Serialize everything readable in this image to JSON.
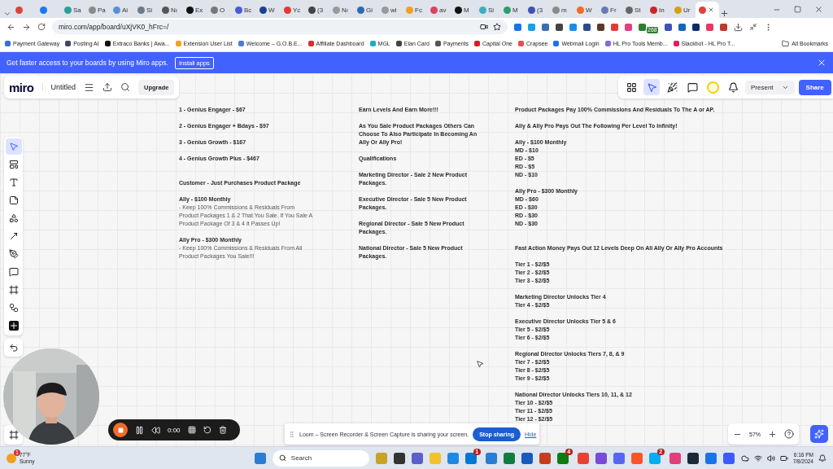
{
  "browser": {
    "tabs": [
      {
        "selected": false,
        "color": "#e0413b"
      },
      {
        "selected": false,
        "color": "#1877f2"
      },
      {
        "label": "Sa",
        "selected": false,
        "color": "#2aa198"
      },
      {
        "label": "Pa",
        "selected": false,
        "color": "#8a8a8a"
      },
      {
        "label": "Ai",
        "selected": false,
        "color": "#5a8fd8"
      },
      {
        "label": "Si",
        "selected": false,
        "color": "#6a7a8a"
      },
      {
        "label": "Nı",
        "selected": false,
        "color": "#555555"
      },
      {
        "label": "Ex",
        "selected": false,
        "color": "#111111"
      },
      {
        "label": "O",
        "selected": false,
        "color": "#777777"
      },
      {
        "label": "Bc",
        "selected": false,
        "color": "#4a5bd4"
      },
      {
        "label": "W",
        "selected": false,
        "color": "#1d3f8f"
      },
      {
        "label": "Yc",
        "selected": false,
        "color": "#e53935"
      },
      {
        "label": "(3",
        "selected": false,
        "color": "#444444"
      },
      {
        "label": "Nı",
        "selected": false,
        "color": "#999999"
      },
      {
        "label": "Gi",
        "selected": false,
        "color": "#2b6cb0"
      },
      {
        "label": "wi",
        "selected": false,
        "color": "#9a9a9a"
      },
      {
        "label": "Fc",
        "selected": false,
        "color": "#f0a020"
      },
      {
        "label": "av",
        "selected": false,
        "color": "#e04060"
      },
      {
        "label": "M",
        "selected": false,
        "color": "#111111"
      },
      {
        "label": "Si",
        "selected": false,
        "color": "#3ab0c0"
      },
      {
        "label": "M",
        "selected": false,
        "color": "#2e9e6a"
      },
      {
        "label": "(3",
        "selected": false,
        "color": "#3f51b5"
      },
      {
        "label": "m",
        "selected": false,
        "color": "#8a8a8a"
      },
      {
        "label": "W",
        "selected": false,
        "color": "#f06a2a"
      },
      {
        "label": "Fr",
        "selected": false,
        "color": "#6a7ab0"
      },
      {
        "label": "St",
        "selected": false,
        "color": "#666666"
      },
      {
        "label": "In",
        "selected": false,
        "color": "#c62828"
      },
      {
        "label": "Ur",
        "selected": false,
        "color": "#d4a017"
      },
      {
        "selected": true,
        "color": "#e0413b"
      }
    ],
    "url": "miro.com/app/board/uXjVK0_hFrc=/",
    "extensions": [
      {
        "color": "#1a73e8"
      },
      {
        "color": "#1aa0e8"
      },
      {
        "color": "#3b6fb0"
      },
      {
        "color": "#444444"
      },
      {
        "color": "#1a8fe8"
      },
      {
        "color": "#2b4a8a"
      },
      {
        "color": "#5a3a2a"
      },
      {
        "color": "#e53935"
      },
      {
        "color": "#e04080"
      },
      {
        "color": "#2e7d32",
        "badge": "268"
      },
      {
        "color": "#3f51b5"
      },
      {
        "color": "#1565c0"
      },
      {
        "color": "#0d2a6a"
      },
      {
        "color": "#e53960"
      },
      {
        "color": "#c0392b"
      }
    ],
    "bookmarks": [
      {
        "label": "Payment Gateway",
        "color": "#3b6fd4"
      },
      {
        "label": "Posting AI",
        "color": "#444466"
      },
      {
        "label": "Extraco Banks | Awa...",
        "color": "#111111"
      },
      {
        "label": "Extension User List",
        "color": "#f4a020"
      },
      {
        "label": "Welcome – G.O.B.E...",
        "color": "#4c7bd9"
      },
      {
        "label": "Affiliate Dashboard",
        "color": "#d63030"
      },
      {
        "label": "MGL",
        "color": "#22aabb"
      },
      {
        "label": "Elan Card",
        "color": "#444444"
      },
      {
        "label": "Payments",
        "color": "#555555"
      },
      {
        "label": "Capital One",
        "color": "#d22020"
      },
      {
        "label": "Crapsee",
        "color": "#e55050"
      },
      {
        "label": "Webmail Login",
        "color": "#1a73e8"
      },
      {
        "label": "HL Pro Tools Memb...",
        "color": "#8a6ad0"
      },
      {
        "label": "Slackbot - HL Pro T...",
        "color": "#e01e5a"
      }
    ],
    "all_bookmarks": "All Bookmarks"
  },
  "banner": {
    "text": "Get faster access to your boards by using Miro apps.",
    "button": "Install apps"
  },
  "miro": {
    "logo": "miro",
    "board_title": "Untitled",
    "upgrade": "Upgrade",
    "present": "Present",
    "share": "Share",
    "top_tools": [
      {
        "kind": "apps",
        "selected": false
      },
      {
        "kind": "cursor",
        "selected": true
      },
      {
        "kind": "party",
        "selected": false
      },
      {
        "kind": "comment",
        "selected": false
      },
      {
        "kind": "avatar",
        "selected": false
      },
      {
        "kind": "bell",
        "selected": false
      }
    ],
    "left_tools": [
      {
        "kind": "select",
        "selected": true
      },
      {
        "kind": "template",
        "selected": false
      },
      {
        "kind": "text",
        "selected": false
      },
      {
        "kind": "sticky",
        "selected": false
      },
      {
        "kind": "shapes",
        "selected": false
      },
      {
        "kind": "line",
        "selected": false
      },
      {
        "kind": "pen",
        "selected": false
      },
      {
        "kind": "comment",
        "selected": false
      },
      {
        "kind": "frame",
        "selected": false
      },
      {
        "kind": "diagram",
        "selected": false
      },
      {
        "kind": "more",
        "selected": false
      }
    ],
    "zoom": "57%",
    "canvas": {
      "columns": [
        {
          "groups": [
            [
              [
                {
                  "text": "1 - Genius Engager - $67",
                  "kind": "bold"
                }
              ],
              [
                {
                  "text": "2 - Genius Engager + Bdays - $97",
                  "kind": "bold"
                }
              ],
              [
                {
                  "text": "3 - Genius Growth - $167",
                  "kind": "bold"
                }
              ],
              [
                {
                  "text": "4 - Genius Growth Plus - $467",
                  "kind": "bold"
                }
              ]
            ],
            [
              [
                {
                  "text": "Customer - Just Purchases Product Package",
                  "kind": "bold"
                }
              ],
              [
                {
                  "text": "Ally - $100 Monthly",
                  "kind": "bold"
                },
                {
                  "text": "- Keep 100% Commissions & Residuals From Product Packages 1 & 2 That You Sale. If You Sale A Product Package Of 3 & 4 It Passes Up!",
                  "kind": "plain"
                }
              ],
              [
                {
                  "text": "Ally Pro - $300 Monthly",
                  "kind": "bold"
                },
                {
                  "text": "- Keep 100% Commissions & Residuals From All Product Packages You Sale!!!",
                  "kind": "plain"
                }
              ]
            ]
          ]
        },
        {
          "groups": [
            [
              [
                {
                  "text": "Earn Levels And Earn More!!!",
                  "kind": "bold"
                }
              ],
              [
                {
                  "text": "As You Sale Product Packages Others Can Choose To Also Participate In Becoming An Ally Or Ally Pro!",
                  "kind": "bold"
                }
              ],
              [
                {
                  "text": "Qualifications",
                  "kind": "bold"
                }
              ],
              [
                {
                  "text": "Marketing Director - Sale 2 New Product Packages.",
                  "kind": "bold"
                }
              ],
              [
                {
                  "text": "Executive Director - Sale 5 New Product Packages.",
                  "kind": "bold"
                }
              ],
              [
                {
                  "text": "Regional Director - Sale 5 New Product Packages.",
                  "kind": "bold"
                }
              ],
              [
                {
                  "text": "National Director - Sale 5 New Product Packages.",
                  "kind": "bold"
                }
              ]
            ]
          ]
        },
        {
          "groups": [
            [
              [
                {
                  "text": "Product Packages Pay 100% Commissions And Residuals To The A or AP.",
                  "kind": "bold"
                }
              ],
              [
                {
                  "text": "Ally & Ally Pro Pays Out The Following Per Level To Infinity!",
                  "kind": "bold"
                }
              ],
              [
                {
                  "text": "Ally - $100 Monthly",
                  "kind": "bold"
                },
                {
                  "text": "MD - $10",
                  "kind": "bold"
                },
                {
                  "text": "ED - $5",
                  "kind": "bold"
                },
                {
                  "text": "RD - $5",
                  "kind": "bold"
                },
                {
                  "text": "ND - $10",
                  "kind": "bold"
                }
              ],
              [
                {
                  "text": "Ally Pro - $300 Monthly",
                  "kind": "bold"
                },
                {
                  "text": "MD - $60",
                  "kind": "bold"
                },
                {
                  "text": "ED - $30",
                  "kind": "bold"
                },
                {
                  "text": "RD - $30",
                  "kind": "bold"
                },
                {
                  "text": "ND - $30",
                  "kind": "bold"
                }
              ]
            ],
            [
              [
                {
                  "text": "Fast Action Money Pays Out 12 Levels Deep On All Ally Or Ally Pro Accounts",
                  "kind": "bold"
                }
              ],
              [
                {
                  "text": "Tier 1 - $2/$5",
                  "kind": "bold"
                },
                {
                  "text": "Tier 2 - $2/$5",
                  "kind": "bold"
                },
                {
                  "text": "Tier 3 - $2/$5",
                  "kind": "bold"
                }
              ],
              [
                {
                  "text": "Marketing Director Unlocks Tier 4",
                  "kind": "bold"
                },
                {
                  "text": "Tier 4 - $2/$5",
                  "kind": "bold"
                }
              ],
              [
                {
                  "text": "Executive Director Unlocks Tier 5 & 6",
                  "kind": "bold"
                },
                {
                  "text": "Tier 5 - $2/$5",
                  "kind": "bold"
                },
                {
                  "text": "Tier 6 - $2/$5",
                  "kind": "bold"
                }
              ],
              [
                {
                  "text": "Regional Director Unlocks Tiers 7, 8, & 9",
                  "kind": "bold"
                },
                {
                  "text": "Tier 7 - $2/$5",
                  "kind": "bold"
                },
                {
                  "text": "Tier 8 - $2/$5",
                  "kind": "bold"
                },
                {
                  "text": "Tier 9 - $2/$5",
                  "kind": "bold"
                }
              ],
              [
                {
                  "text": "National Director Unlocks Tiers 10, 11, & 12",
                  "kind": "bold"
                },
                {
                  "text": "Tier 10 - $2/$5",
                  "kind": "bold"
                },
                {
                  "text": "Tier 11 - $2/$5",
                  "kind": "bold"
                },
                {
                  "text": "Tier 12 - $2/$5",
                  "kind": "bold"
                }
              ]
            ]
          ]
        }
      ]
    }
  },
  "loom": {
    "timer": "0:00",
    "notice": "Loom – Screen Recorder & Screen Capture is sharing your screen.",
    "stop": "Stop sharing",
    "hide": "Hide"
  },
  "taskbar": {
    "weather": {
      "badge": "1",
      "temp": "77°F",
      "condition": "Sunny"
    },
    "search": {
      "placeholder": "Search"
    },
    "apps": [
      {
        "color": "#c9a227"
      },
      {
        "color": "#333333"
      },
      {
        "color": "#5b5fc7"
      },
      {
        "color": "#f2c12e"
      },
      {
        "color": "#1e88e5"
      },
      {
        "color": "#0078d4",
        "badge": "1"
      },
      {
        "color": "#2b7cd3"
      },
      {
        "color": "#107c41"
      },
      {
        "color": "#185abd"
      },
      {
        "color": "#c43e1c"
      },
      {
        "color": "#107c10",
        "badge": "4"
      },
      {
        "color": "#e94235"
      },
      {
        "color": "#7a4ad8"
      },
      {
        "color": "#5865f2"
      },
      {
        "color": "#fb542b"
      },
      {
        "color": "#00aff0",
        "badge": "2"
      },
      {
        "color": "#e0407a"
      },
      {
        "color": "#1b2838"
      },
      {
        "color": "#1a73e8"
      },
      {
        "color": "#3d5afe"
      }
    ],
    "time": "6:16 PM",
    "date": "7/8/2024"
  }
}
